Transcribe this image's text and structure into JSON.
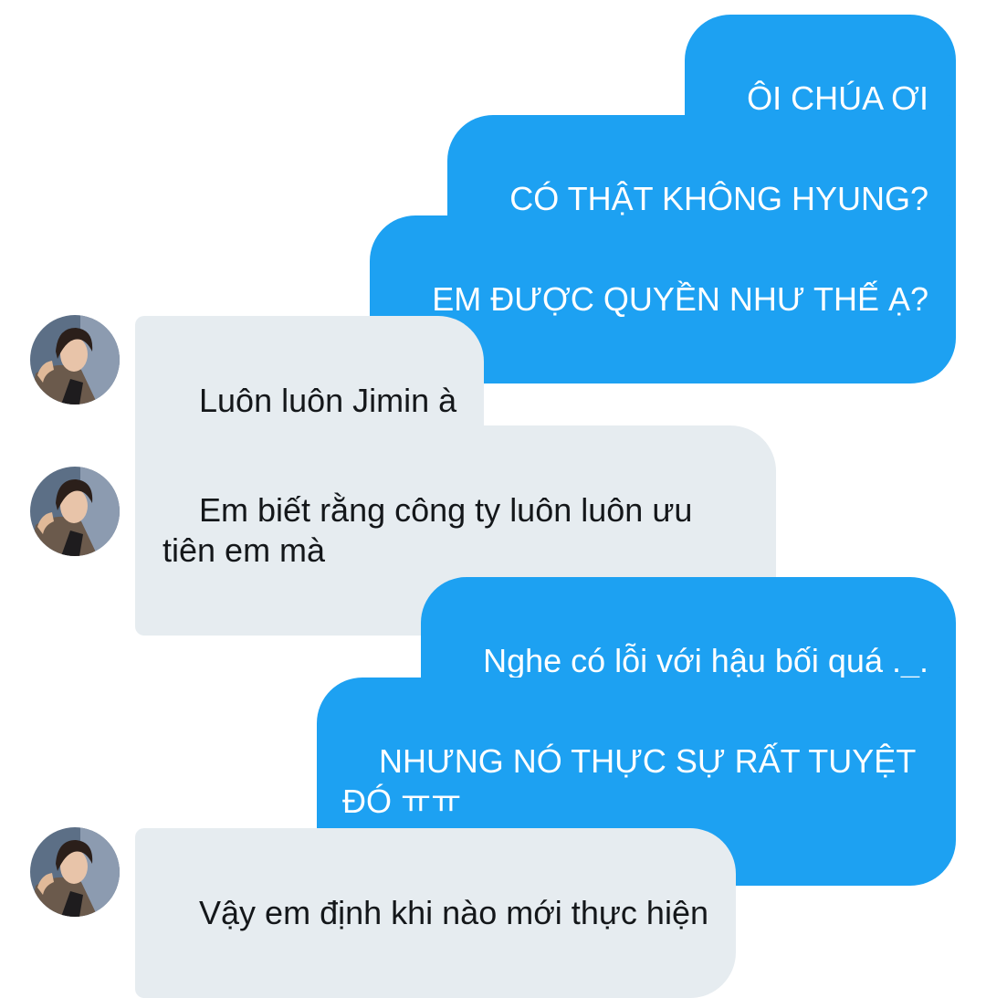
{
  "conversation": {
    "messages": [
      {
        "direction": "outgoing",
        "text": "ÔI CHÚA ƠI"
      },
      {
        "direction": "outgoing",
        "text": "CÓ THẬT KHÔNG HYUNG?"
      },
      {
        "direction": "outgoing",
        "text": "EM ĐƯỢC QUYỀN NHƯ THẾ Ạ?"
      },
      {
        "direction": "incoming",
        "text": "Luôn luôn Jimin à"
      },
      {
        "direction": "incoming",
        "text": "Em biết rằng công ty luôn luôn ưu tiên em mà"
      },
      {
        "direction": "outgoing",
        "text": "Nghe có lỗi với hậu bối quá ._."
      },
      {
        "direction": "outgoing",
        "text": "NHƯNG NÓ THỰC SỰ RẤT TUYỆT ĐÓ ㅠㅠ"
      },
      {
        "direction": "incoming",
        "text": "Vậy em định khi nào mới thực hiện"
      }
    ]
  },
  "contact": {
    "avatar_icon": "user-avatar-photo"
  },
  "colors": {
    "outgoing_bubble": "#1da1f2",
    "outgoing_text": "#ffffff",
    "incoming_bubble": "#e6ecf0",
    "incoming_text": "#14171a",
    "background": "#ffffff"
  }
}
